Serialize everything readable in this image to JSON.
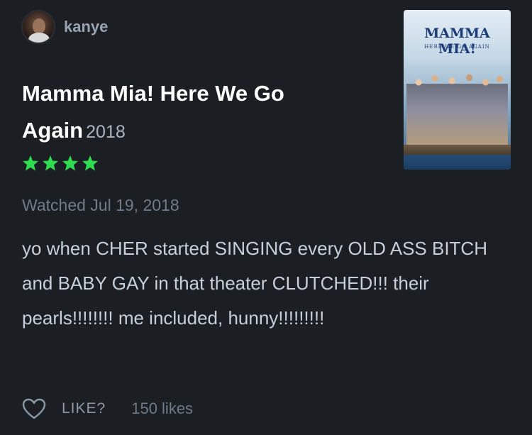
{
  "user": {
    "username": "kanye"
  },
  "film": {
    "title": "Mamma Mia! Here We Go Again",
    "year": "2018"
  },
  "rating": {
    "stars": 4,
    "max_stars": 5
  },
  "watched": "Watched Jul 19, 2018",
  "review": "yo when CHER started SINGING every OLD ASS BITCH and BABY GAY in that theater CLUTCHED!!! their pearls!!!!!!!! me included, hunny!!!!!!!!!",
  "poster": {
    "title_text": "MAMMA MIA!",
    "subtitle_text": "HERE WE GO AGAIN"
  },
  "footer": {
    "like_label": "LIKE?",
    "like_count": "150 likes"
  },
  "colors": {
    "star": "#2fdb4f",
    "background": "#1b1e23"
  }
}
